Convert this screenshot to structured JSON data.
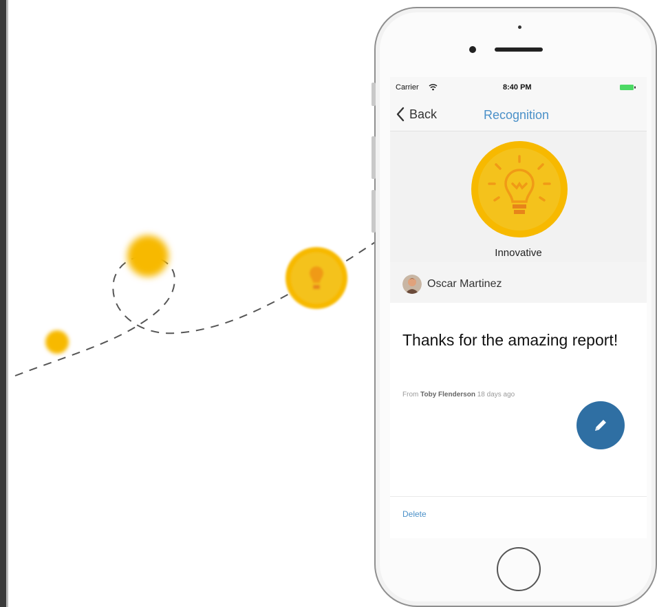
{
  "status_bar": {
    "carrier": "Carrier",
    "time": "8:40 PM"
  },
  "nav": {
    "back_label": "Back",
    "title": "Recognition"
  },
  "badge": {
    "name": "Innovative",
    "icon": "lightbulb-icon",
    "color": "#f7b900"
  },
  "recipient": {
    "name": "Oscar Martinez"
  },
  "message": {
    "text": "Thanks for the amazing report!",
    "from_prefix": "From",
    "from_name": "Toby Flenderson",
    "time_ago": "18 days ago"
  },
  "actions": {
    "delete_label": "Delete",
    "fab_icon": "pencil-icon",
    "fab_color": "#2f6fa3"
  },
  "colors": {
    "accent": "#4a90c8",
    "coin": "#f7b900"
  }
}
